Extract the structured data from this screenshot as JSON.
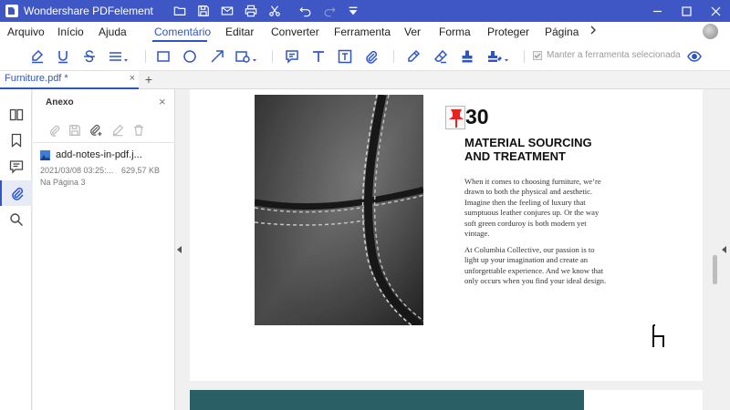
{
  "app": {
    "title": "Wondershare PDFelement"
  },
  "menu": {
    "items": [
      "Arquivo",
      "Início",
      "Ajuda",
      "Comentário",
      "Editar",
      "Converter",
      "Ferramenta",
      "Ver",
      "Forma",
      "Proteger",
      "Página"
    ],
    "active": "Comentário",
    "more_icon": "chevron-right-icon"
  },
  "toolbar": {
    "keep_tool_label": "Manter a ferramenta selecionada",
    "keep_tool_checked": true
  },
  "tabs": {
    "document": "Furniture.pdf *",
    "close_glyph": "×",
    "new_tab_glyph": "+"
  },
  "panel": {
    "title": "Anexo",
    "close_glyph": "×",
    "attachment": {
      "name": "add-notes-in-pdf.j...",
      "date": "2021/03/08 03:25:...",
      "size": "629,57 KB",
      "page": "Na Página 3"
    }
  },
  "document": {
    "number": "30",
    "heading": "MATERIAL SOURCING AND TREATMENT",
    "paragraph1": "When it comes to choosing furniture, we’re drawn to both the physical and aesthetic. Imagine then the feeling of luxury that sumptuous leather conjures up. Or the way soft green corduroy is both modern yet vintage.",
    "paragraph2": "At Columbia Collective, our passion is to light up your imagination and create an unforgettable experience. And we know that only occurs when you find your ideal design."
  },
  "colors": {
    "titlebar": "#3f57c4",
    "accent": "#2e55c8",
    "pin": "#e8231f",
    "teal_block": "#2a5f66"
  }
}
